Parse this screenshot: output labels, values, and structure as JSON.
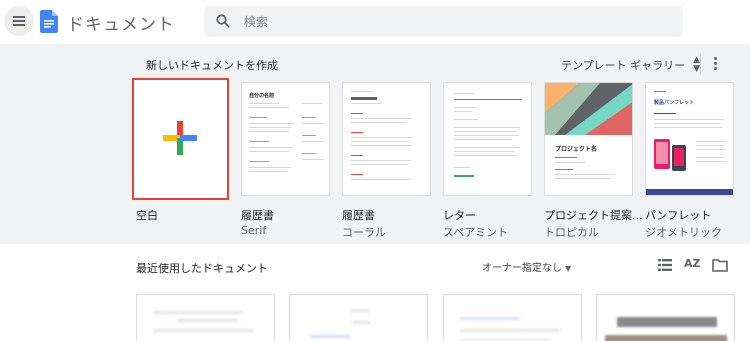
{
  "header": {
    "app_title": "ドキュメント",
    "search_placeholder": "検索",
    "menu_icon": "hamburger-menu-icon",
    "logo_icon": "docs-logo-icon"
  },
  "templates": {
    "section_title": "新しいドキュメントを作成",
    "gallery_label": "テンプレート ギャラリー",
    "items": [
      {
        "name": "空白",
        "subtitle": ""
      },
      {
        "name": "履歴書",
        "subtitle": "Serif",
        "heading": "自分の名前"
      },
      {
        "name": "履歴書",
        "subtitle": "コーラル"
      },
      {
        "name": "レター",
        "subtitle": "スペアミント"
      },
      {
        "name": "プロジェクト提案...",
        "subtitle": "トロピカル",
        "heading": "プロジェクト名"
      },
      {
        "name": "パンフレット",
        "subtitle": "ジオメトリック",
        "heading": "製品パンフレット"
      }
    ]
  },
  "recent": {
    "section_title": "最近使用したドキュメント",
    "owner_filter": "オーナー指定なし",
    "sort_label": "AZ"
  },
  "colors": {
    "accent_red": "#ea4335",
    "accent_blue": "#4285f4",
    "accent_green": "#34a853",
    "accent_yellow": "#fbbc04",
    "panel_bg": "#f1f3f4"
  }
}
